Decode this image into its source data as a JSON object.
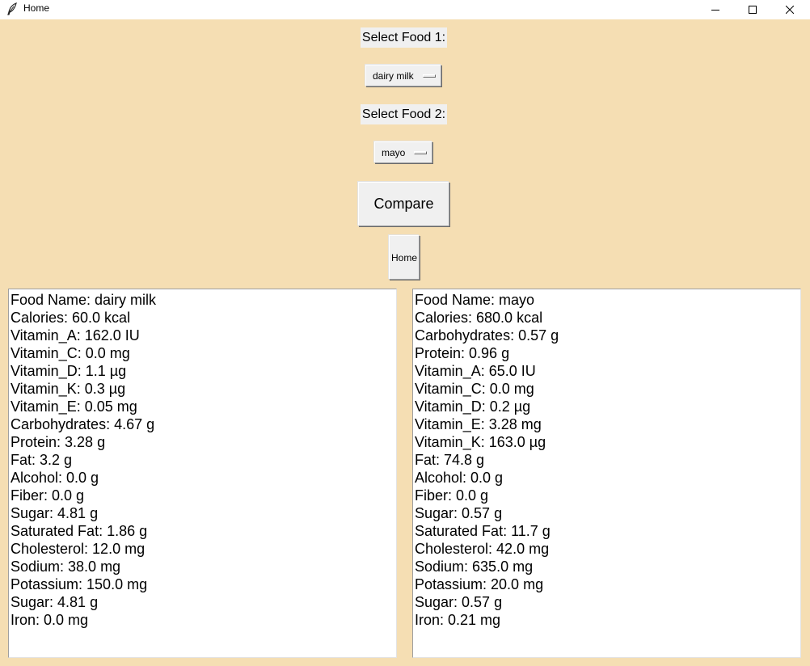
{
  "window": {
    "title": "Home",
    "icon": "feather-icon"
  },
  "form": {
    "food1_label": "Select Food 1:",
    "food1_value": "dairy milk",
    "food2_label": "Select Food 2:",
    "food2_value": "mayo",
    "compare_label": "Compare",
    "home_label": "Home"
  },
  "colors": {
    "background": "#f5deb3",
    "widget": "#f0f0f0",
    "panel": "#ffffff"
  },
  "panels": {
    "left": [
      "Food Name: dairy milk",
      "Calories: 60.0 kcal",
      "Vitamin_A: 162.0 IU",
      "Vitamin_C: 0.0 mg",
      "Vitamin_D: 1.1 µg",
      "Vitamin_K: 0.3 µg",
      "Vitamin_E: 0.05 mg",
      "Carbohydrates: 4.67 g",
      "Protein: 3.28 g",
      "Fat: 3.2 g",
      "Alcohol: 0.0 g",
      "Fiber: 0.0 g",
      "Sugar: 4.81 g",
      "Saturated Fat: 1.86 g",
      "Cholesterol: 12.0 mg",
      "Sodium: 38.0 mg",
      "Potassium: 150.0 mg",
      "Sugar: 4.81 g",
      "Iron: 0.0 mg"
    ],
    "right": [
      "Food Name: mayo",
      "Calories: 680.0 kcal",
      "Carbohydrates: 0.57 g",
      "Protein: 0.96 g",
      "Vitamin_A: 65.0 IU",
      "Vitamin_C: 0.0 mg",
      "Vitamin_D: 0.2 µg",
      "Vitamin_E: 3.28 mg",
      "Vitamin_K: 163.0 µg",
      "Fat: 74.8 g",
      "Alcohol: 0.0 g",
      "Fiber: 0.0 g",
      "Sugar: 0.57 g",
      "Saturated Fat: 11.7 g",
      "Cholesterol: 42.0 mg",
      "Sodium: 635.0 mg",
      "Potassium: 20.0 mg",
      "Sugar: 0.57 g",
      "Iron: 0.21 mg"
    ]
  }
}
